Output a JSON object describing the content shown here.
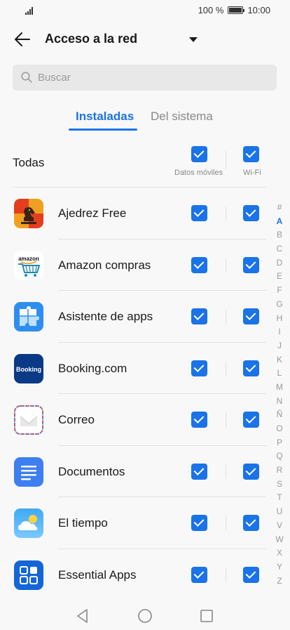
{
  "status_bar": {
    "battery": "100 %",
    "time": "10:00"
  },
  "header": {
    "title": "Acceso a la red"
  },
  "search": {
    "placeholder": "Buscar"
  },
  "tabs": [
    {
      "label": "Instaladas",
      "active": true
    },
    {
      "label": "Del sistema",
      "active": false
    }
  ],
  "all_row": {
    "label": "Todas",
    "mobile_data_label": "Datos móviles",
    "wifi_label": "Wi-Fi",
    "mobile_data_checked": true,
    "wifi_checked": true
  },
  "apps": [
    {
      "name": "Ajedrez Free",
      "icon": "chess-icon",
      "mobile_data": true,
      "wifi": true
    },
    {
      "name": "Amazon compras",
      "icon": "amazon-icon",
      "icon_text": "amazon",
      "mobile_data": true,
      "wifi": true
    },
    {
      "name": "Asistente de apps",
      "icon": "puzzle-icon",
      "mobile_data": true,
      "wifi": true
    },
    {
      "name": "Booking.com",
      "icon": "booking-icon",
      "icon_text": "Booking",
      "mobile_data": true,
      "wifi": true
    },
    {
      "name": "Correo",
      "icon": "mail-icon",
      "mobile_data": true,
      "wifi": true
    },
    {
      "name": "Documentos",
      "icon": "documents-icon",
      "mobile_data": true,
      "wifi": true
    },
    {
      "name": "El tiempo",
      "icon": "weather-icon",
      "mobile_data": true,
      "wifi": true
    },
    {
      "name": "Essential Apps",
      "icon": "grid-apps-icon",
      "mobile_data": true,
      "wifi": true
    }
  ],
  "alphabet": [
    "#",
    "A",
    "B",
    "C",
    "D",
    "E",
    "F",
    "G",
    "H",
    "I",
    "J",
    "K",
    "L",
    "M",
    "N",
    "Ñ",
    "O",
    "P",
    "Q",
    "R",
    "S",
    "T",
    "U",
    "V",
    "W",
    "X",
    "Y",
    "Z"
  ],
  "alphabet_active": "A",
  "colors": {
    "accent": "#1a73e8",
    "background": "#f8f8f8"
  }
}
